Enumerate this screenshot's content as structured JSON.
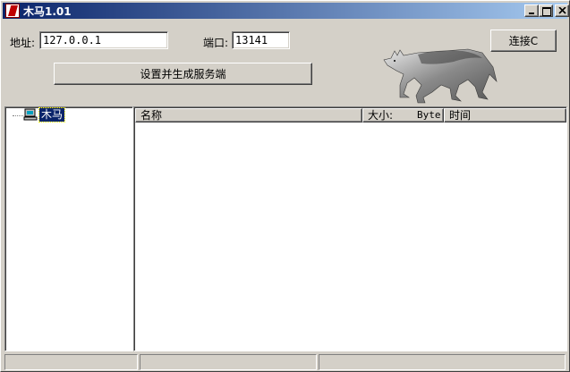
{
  "window": {
    "title": "木马1.01",
    "app_icon": "trojan-app-icon",
    "controls": {
      "minimize": "minimize-icon",
      "maximize": "maximize-icon",
      "close": "close-icon"
    }
  },
  "connection": {
    "address_label": "地址:",
    "address_value": "127.0.0.1",
    "port_label": "端口:",
    "port_value": "13141",
    "connect_button": "连接C"
  },
  "setup_button": "设置并生成服务端",
  "tree": {
    "items": [
      {
        "label": "木马",
        "icon": "computer-icon",
        "selected": true
      }
    ]
  },
  "file_list": {
    "columns": [
      {
        "label": "名称"
      },
      {
        "label": "大小:",
        "unit": "Byte"
      },
      {
        "label": "时间"
      }
    ],
    "rows": []
  },
  "statusbar": {
    "panes": [
      "",
      "",
      ""
    ]
  },
  "colors": {
    "titlebar_start": "#0a246a",
    "titlebar_end": "#a6caf0",
    "face": "#d4d0c8",
    "selection": "#0a246a"
  }
}
